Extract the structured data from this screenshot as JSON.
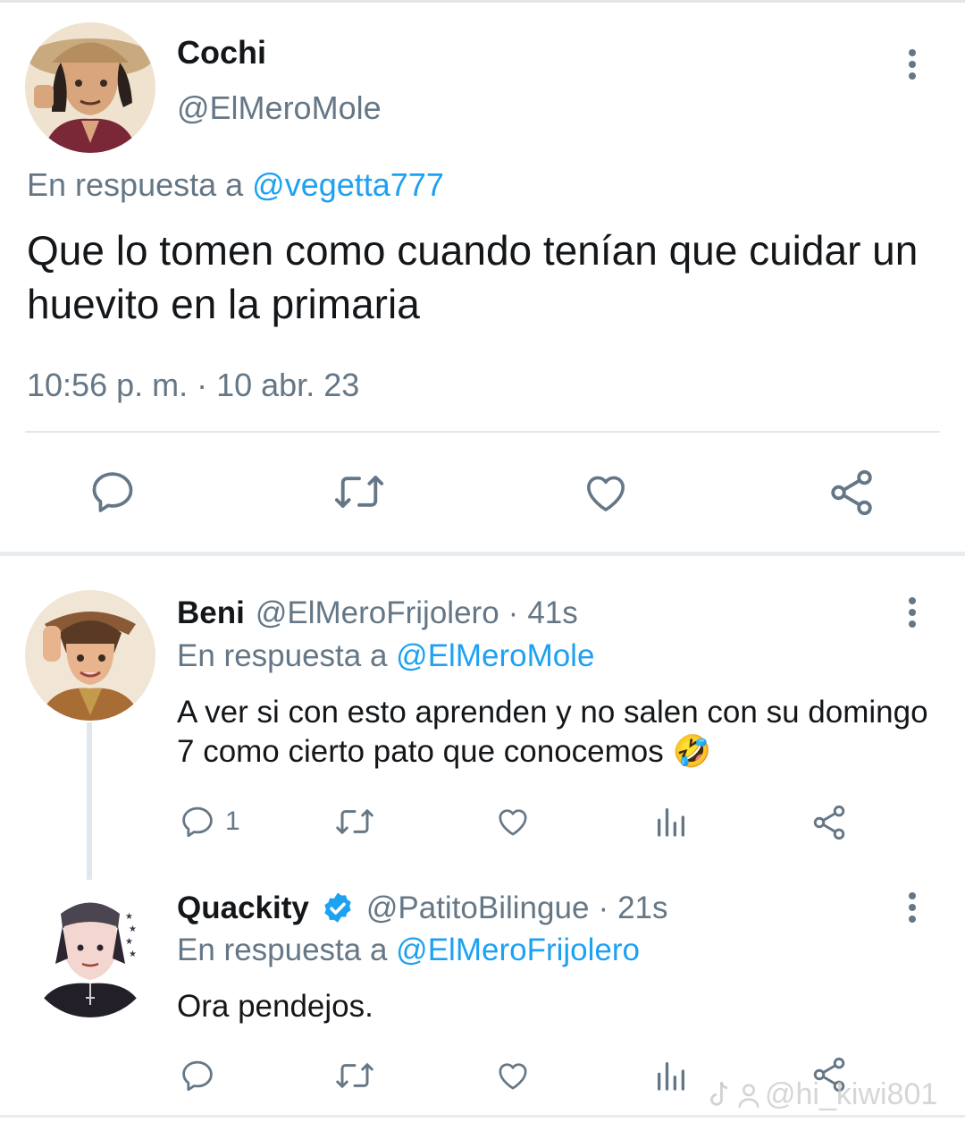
{
  "main_tweet": {
    "author_name": "Cochi",
    "author_handle": "@ElMeroMole",
    "reply_prefix": "En respuesta a",
    "reply_to": "@vegetta777",
    "text": "Que lo tomen como cuando tenían que cuidar un huevito en la primaria",
    "timestamp": "10:56 p. m. · 10 abr. 23",
    "actions": [
      "reply-icon",
      "retweet-icon",
      "like-icon",
      "share-icon"
    ]
  },
  "replies": [
    {
      "author_name": "Beni",
      "author_handle": "@ElMeroFrijolero",
      "separator": "·",
      "time": "41s",
      "reply_prefix": "En respuesta a",
      "reply_to": "@ElMeroMole",
      "text": "A ver si con esto aprenden y no salen con su domingo 7 como cierto pato que conocemos 🤣",
      "reply_count": "1"
    },
    {
      "author_name": "Quackity",
      "verified": true,
      "author_handle": "@PatitoBilingue",
      "separator": "·",
      "time": "21s",
      "reply_prefix": "En respuesta a",
      "reply_to": "@ElMeroFrijolero",
      "text": "Ora pendejos.",
      "reply_count": ""
    }
  ],
  "watermark": "@hi_kiwi801",
  "colors": {
    "text": "#14171a",
    "secondary": "#657786",
    "link": "#1da1f2",
    "verified": "#1da1f2",
    "divider": "#e1e8ed"
  }
}
